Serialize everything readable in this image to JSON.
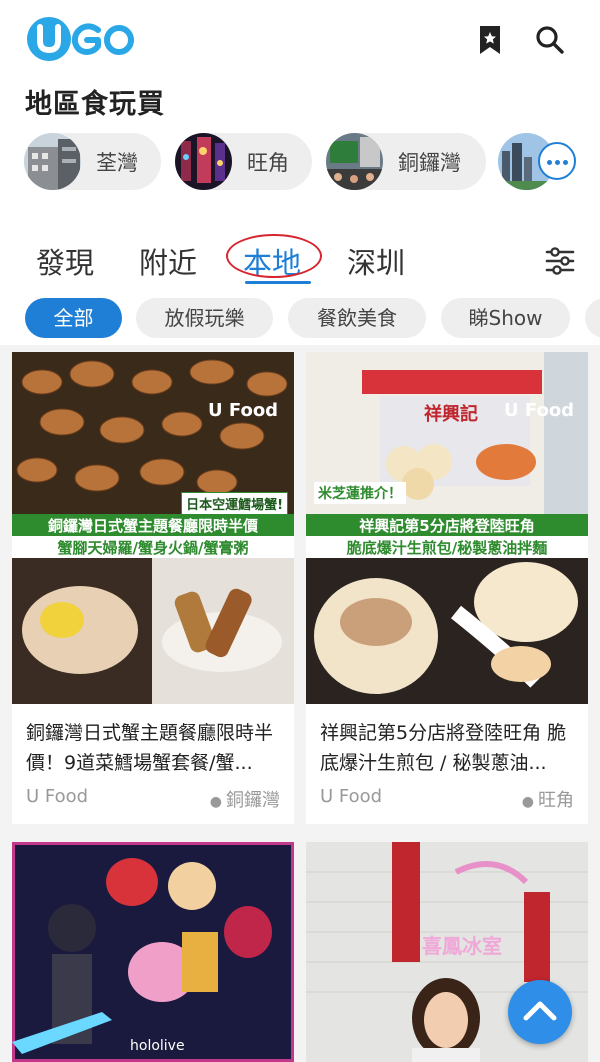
{
  "header": {
    "logo_text": "UGO",
    "bookmark_icon": "bookmark-icon",
    "search_icon": "search-icon"
  },
  "section_title": "地區食玩買",
  "districts": [
    {
      "label": "荃灣"
    },
    {
      "label": "旺角"
    },
    {
      "label": "銅鑼灣"
    }
  ],
  "tabs": [
    {
      "label": "發現",
      "active": false
    },
    {
      "label": "附近",
      "active": false
    },
    {
      "label": "本地",
      "active": true
    },
    {
      "label": "深圳",
      "active": false
    }
  ],
  "categories": [
    {
      "label": "全部",
      "active": true
    },
    {
      "label": "放假玩樂",
      "active": false
    },
    {
      "label": "餐飲美食",
      "active": false
    },
    {
      "label": "睇Show",
      "active": false
    }
  ],
  "cards": [
    {
      "title": "銅鑼灣日式蟹主題餐廳限時半價！9道菜鱈場蟹套餐/蟹...",
      "source": "U Food",
      "location": "銅鑼灣",
      "image": {
        "brand": "U Food",
        "tag": "日本空運鱈場蟹!",
        "headline": "銅鑼灣日式蟹主題餐廳限時半價",
        "subline": "蟹腳天婦羅/蟹身火鍋/蟹膏粥"
      }
    },
    {
      "title": "祥興記第5分店將登陸旺角 脆底爆汁生煎包 / 秘製蔥油...",
      "source": "U Food",
      "location": "旺角",
      "image": {
        "brand": "U Food",
        "sign": "祥興記",
        "tag": "米芝蓮推介！",
        "headline": "祥興記第5分店將登陸旺角",
        "subline": "脆底爆汁生煎包/秘製蔥油拌麵"
      }
    },
    {
      "title": "",
      "image": {
        "watermark": "hololive"
      }
    },
    {
      "title": "",
      "image": {
        "sign": "喜鳳冰室"
      }
    }
  ],
  "colors": {
    "accent": "#1f7fd6",
    "annotation": "#d6262f",
    "banner_green": "#2e8b2e",
    "banner_yellow": "#f2c94c"
  }
}
